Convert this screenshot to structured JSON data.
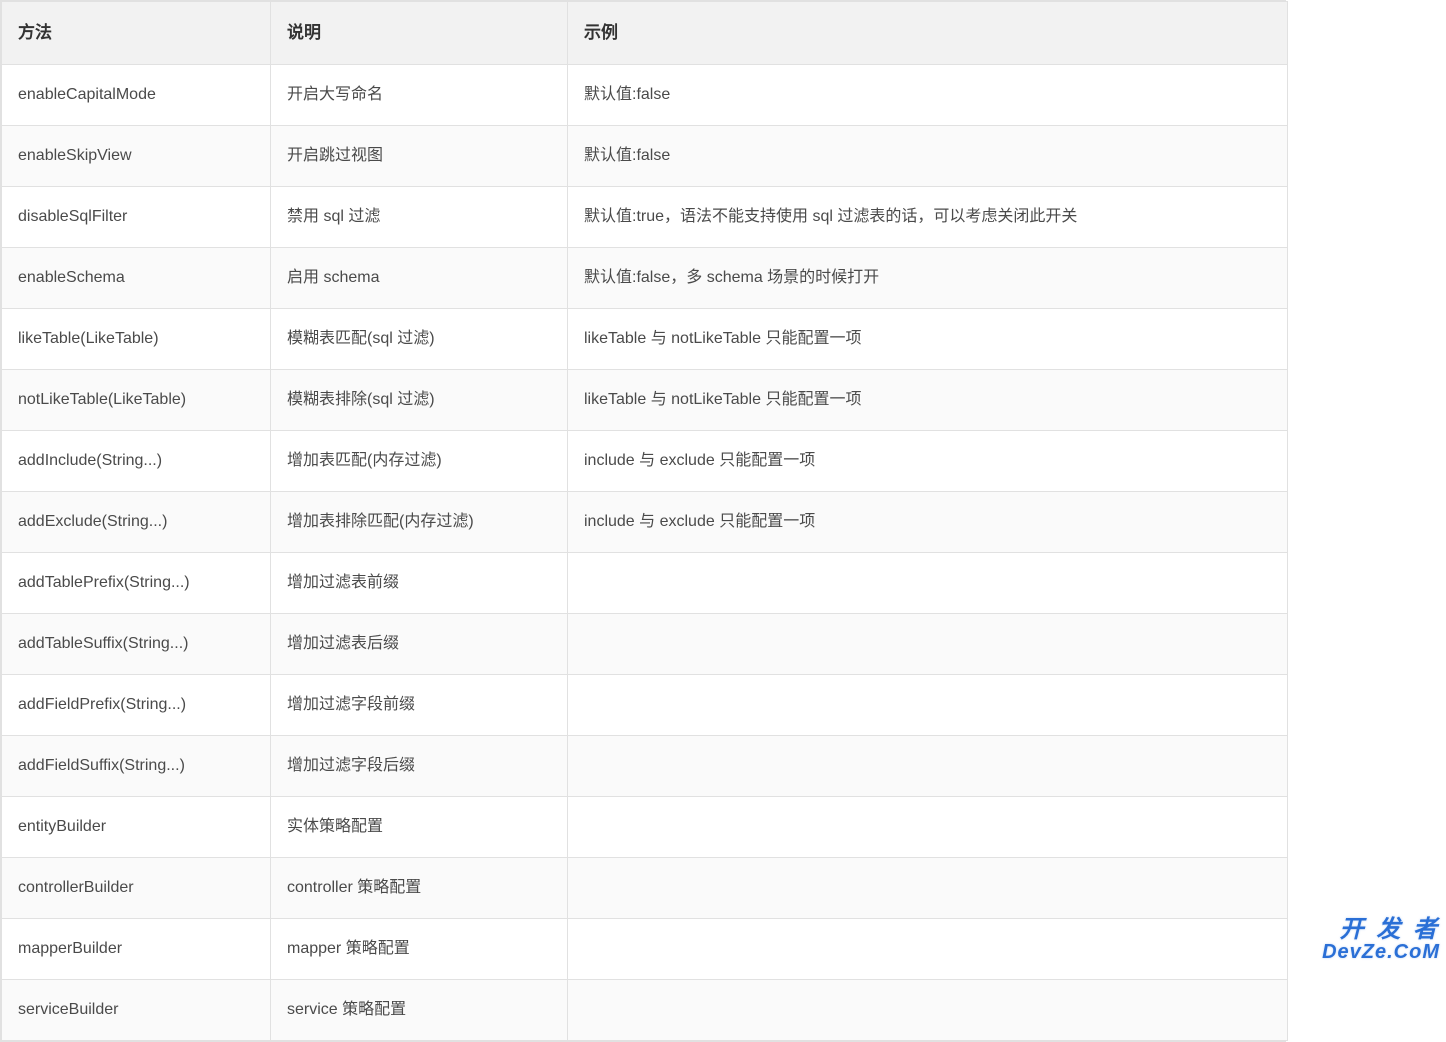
{
  "table": {
    "headers": {
      "method": "方法",
      "description": "说明",
      "example": "示例"
    },
    "rows": [
      {
        "method": "enableCapitalMode",
        "description": "开启大写命名",
        "example": "默认值:false"
      },
      {
        "method": "enableSkipView",
        "description": "开启跳过视图",
        "example": "默认值:false"
      },
      {
        "method": "disableSqlFilter",
        "description": "禁用 sql 过滤",
        "example": "默认值:true，语法不能支持使用 sql 过滤表的话，可以考虑关闭此开关"
      },
      {
        "method": "enableSchema",
        "description": "启用 schema",
        "example": "默认值:false，多 schema 场景的时候打开"
      },
      {
        "method": "likeTable(LikeTable)",
        "description": "模糊表匹配(sql 过滤)",
        "example": "likeTable 与 notLikeTable 只能配置一项"
      },
      {
        "method": "notLikeTable(LikeTable)",
        "description": "模糊表排除(sql 过滤)",
        "example": "likeTable 与 notLikeTable 只能配置一项"
      },
      {
        "method": "addInclude(String...)",
        "description": "增加表匹配(内存过滤)",
        "example": "include 与 exclude 只能配置一项"
      },
      {
        "method": "addExclude(String...)",
        "description": "增加表排除匹配(内存过滤)",
        "example": "include 与 exclude 只能配置一项"
      },
      {
        "method": "addTablePrefix(String...)",
        "description": "增加过滤表前缀",
        "example": ""
      },
      {
        "method": "addTableSuffix(String...)",
        "description": "增加过滤表后缀",
        "example": ""
      },
      {
        "method": "addFieldPrefix(String...)",
        "description": "增加过滤字段前缀",
        "example": ""
      },
      {
        "method": "addFieldSuffix(String...)",
        "description": "增加过滤字段后缀",
        "example": ""
      },
      {
        "method": "entityBuilder",
        "description": "实体策略配置",
        "example": ""
      },
      {
        "method": "controllerBuilder",
        "description": "controller 策略配置",
        "example": ""
      },
      {
        "method": "mapperBuilder",
        "description": "mapper 策略配置",
        "example": ""
      },
      {
        "method": "serviceBuilder",
        "description": "service 策略配置",
        "example": ""
      }
    ]
  },
  "watermark": {
    "line1": "开 发 者",
    "line2": "DevZe.CoM"
  }
}
